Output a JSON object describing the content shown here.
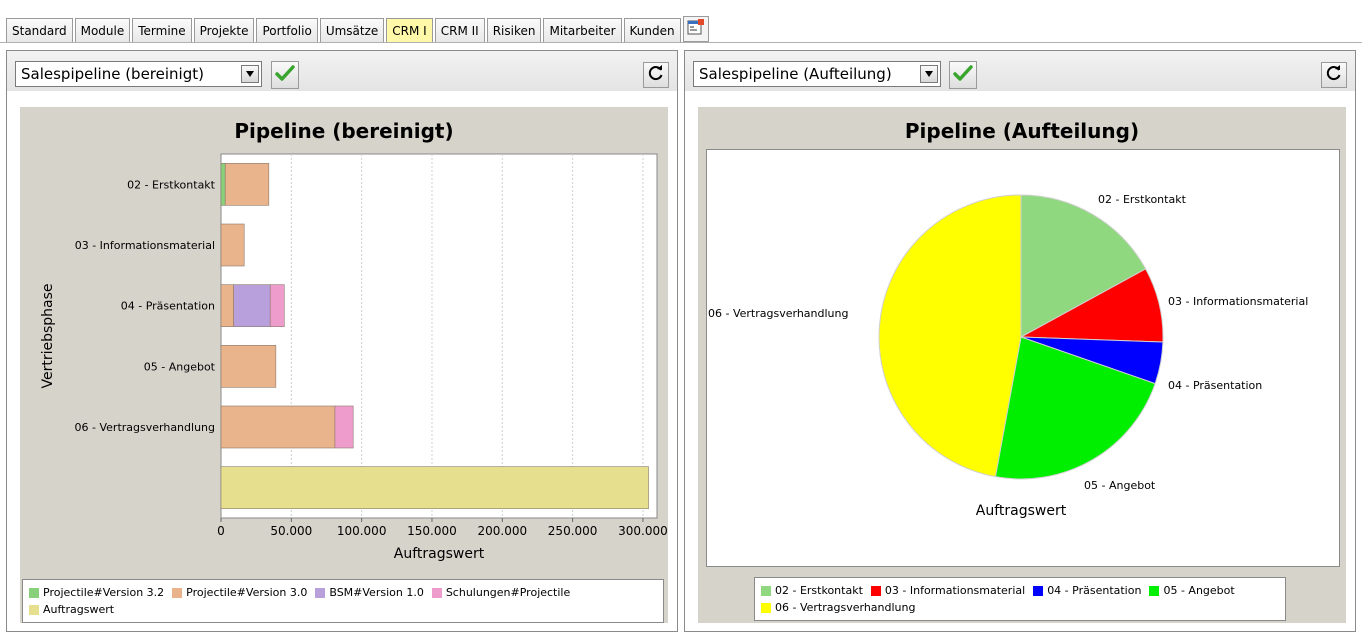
{
  "tabs": [
    {
      "label": "Standard"
    },
    {
      "label": "Module"
    },
    {
      "label": "Termine"
    },
    {
      "label": "Projekte"
    },
    {
      "label": "Portfolio"
    },
    {
      "label": "Umsätze"
    },
    {
      "label": "CRM I",
      "active": true
    },
    {
      "label": "CRM II"
    },
    {
      "label": "Risiken"
    },
    {
      "label": "Mitarbeiter"
    },
    {
      "label": "Kunden"
    }
  ],
  "left_panel": {
    "selected_view": "Salespipeline (bereinigt)",
    "legend": [
      {
        "label": "Projectile#Version 3.2",
        "color": "#88d07a"
      },
      {
        "label": "Projectile#Version 3.0",
        "color": "#e9b48c"
      },
      {
        "label": "BSM#Version 1.0",
        "color": "#b8a0dc"
      },
      {
        "label": "Schulungen#Projectile",
        "color": "#ee9ccc"
      },
      {
        "label": "Auftragswert",
        "color": "#e6e08e"
      }
    ]
  },
  "right_panel": {
    "selected_view": "Salespipeline (Aufteilung)",
    "legend": [
      {
        "label": "02 - Erstkontakt",
        "color": "#8fd87f"
      },
      {
        "label": "03 - Informationsmaterial",
        "color": "#ff0000"
      },
      {
        "label": "04 - Präsentation",
        "color": "#0000ff"
      },
      {
        "label": "05 - Angebot",
        "color": "#00ee00"
      },
      {
        "label": "06 - Vertragsverhandlung",
        "color": "#ffff00"
      }
    ]
  },
  "chart_data": [
    {
      "type": "bar",
      "orientation": "horizontal",
      "stacked": true,
      "title": "Pipeline (bereinigt)",
      "xlabel": "Auftragswert",
      "ylabel": "Vertriebsphase",
      "xlim": [
        0,
        310000
      ],
      "xticks": [
        0,
        50000,
        100000,
        150000,
        200000,
        250000,
        300000
      ],
      "xtick_labels": [
        "0",
        "50.000",
        "100.000",
        "150.000",
        "200.000",
        "250.000",
        "300.000"
      ],
      "grid": true,
      "categories": [
        "02 - Erstkontakt",
        "03 - Informationsmaterial",
        "04 - Präsentation",
        "05 - Angebot",
        "06 - Vertragsverhandlung",
        ""
      ],
      "series": [
        {
          "name": "Projectile#Version 3.2",
          "color": "#88d07a",
          "values": [
            3000,
            0,
            0,
            0,
            0,
            0
          ]
        },
        {
          "name": "Projectile#Version 3.0",
          "color": "#e9b48c",
          "values": [
            31000,
            16500,
            9000,
            39000,
            81000,
            0
          ]
        },
        {
          "name": "BSM#Version 1.0",
          "color": "#b8a0dc",
          "values": [
            0,
            0,
            26000,
            0,
            0,
            0
          ]
        },
        {
          "name": "Schulungen#Projectile",
          "color": "#ee9ccc",
          "values": [
            0,
            0,
            10000,
            0,
            13000,
            0
          ]
        },
        {
          "name": "Auftragswert",
          "color": "#e6e08e",
          "values": [
            0,
            0,
            0,
            0,
            0,
            304000
          ]
        }
      ]
    },
    {
      "type": "pie",
      "title": "Pipeline (Aufteilung)",
      "xlabel": "Auftragswert",
      "slices": [
        {
          "label": "02 - Erstkontakt",
          "value": 34000,
          "color": "#8fd87f"
        },
        {
          "label": "03 - Informationsmaterial",
          "value": 17000,
          "color": "#ff0000"
        },
        {
          "label": "04 - Präsentation",
          "value": 9500,
          "color": "#0000ff"
        },
        {
          "label": "05 - Angebot",
          "value": 45000,
          "color": "#00ee00"
        },
        {
          "label": "06 - Vertragsverhandlung",
          "value": 94000,
          "color": "#ffff00"
        }
      ]
    }
  ]
}
